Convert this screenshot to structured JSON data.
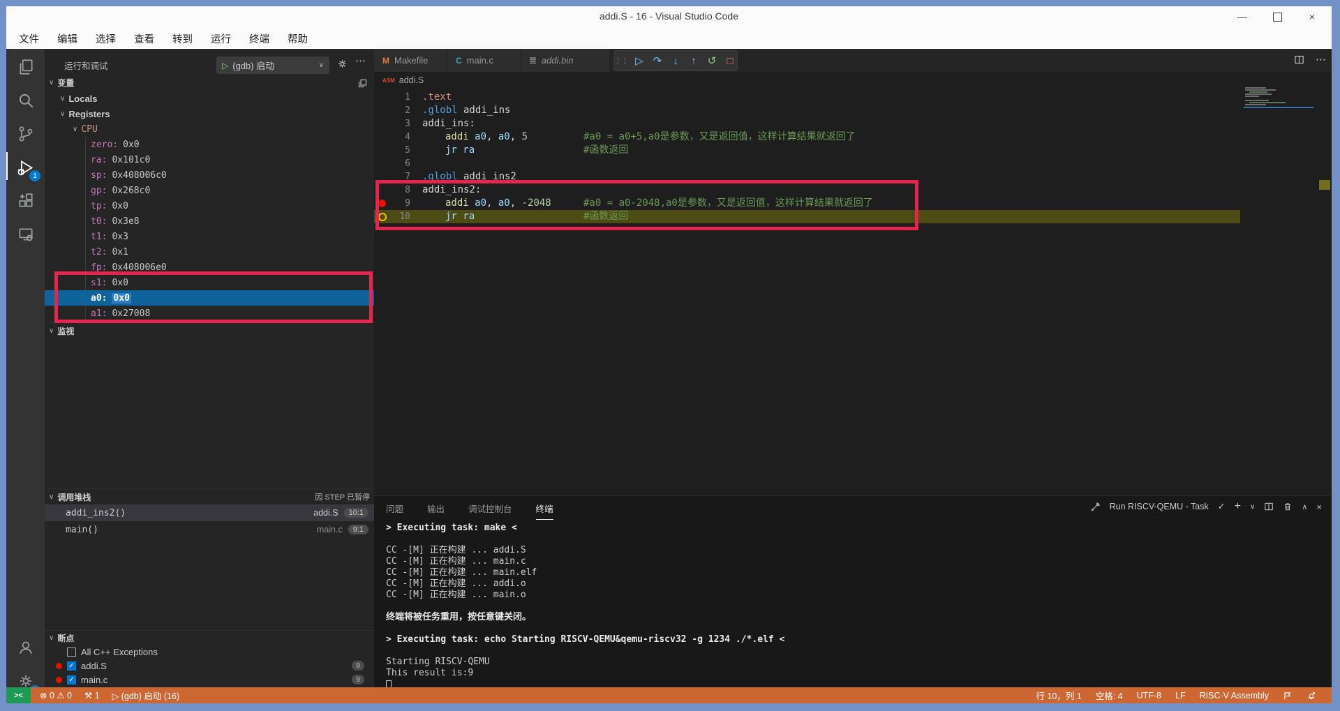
{
  "colors": {
    "annotation_red": "#e4264e",
    "status_bar_orange": "#cc6633",
    "selection_blue": "#0e639c",
    "debug_line_olive": "#4e4c15",
    "remote_green": "#1f9a55",
    "badge_blue": "#007acc"
  },
  "window": {
    "title": "addi.S - 16 - Visual Studio Code"
  },
  "menu": {
    "items": [
      "文件",
      "编辑",
      "选择",
      "查看",
      "转到",
      "运行",
      "终端",
      "帮助"
    ]
  },
  "activity_bar": {
    "debug_badge": "1",
    "settings_badge": "1"
  },
  "sidebar": {
    "title": "运行和调试",
    "launch_config": "(gdb) 启动",
    "variables_label": "变量",
    "tree": {
      "locals": "Locals",
      "registers": "Registers",
      "cpu": "CPU"
    },
    "registers": [
      {
        "name": "zero",
        "value": "0x0",
        "selected": false
      },
      {
        "name": "ra",
        "value": "0x101c0",
        "selected": false
      },
      {
        "name": "sp",
        "value": "0x408006c0",
        "selected": false
      },
      {
        "name": "gp",
        "value": "0x268c0",
        "selected": false
      },
      {
        "name": "tp",
        "value": "0x0",
        "selected": false
      },
      {
        "name": "t0",
        "value": "0x3e8",
        "selected": false
      },
      {
        "name": "t1",
        "value": "0x3",
        "selected": false
      },
      {
        "name": "t2",
        "value": "0x1",
        "selected": false
      },
      {
        "name": "fp",
        "value": "0x408006e0",
        "selected": false
      },
      {
        "name": "s1",
        "value": "0x0",
        "selected": false
      },
      {
        "name": "a0",
        "value": "0x0",
        "selected": true
      },
      {
        "name": "a1",
        "value": "0x27008",
        "selected": false
      }
    ],
    "watch_label": "监视",
    "call_stack": {
      "label": "调用堆栈",
      "status": "因 STEP 已暂停",
      "frames": [
        {
          "func": "addi_ins2()",
          "file": "addi.S",
          "position": "10:1",
          "selected": true
        },
        {
          "func": "main()",
          "file": "main.c",
          "position": "9:1",
          "selected": false
        }
      ]
    },
    "breakpoints": {
      "label": "断点",
      "items": [
        {
          "label": "All C++ Exceptions",
          "checked": false,
          "dot": false,
          "badge": ""
        },
        {
          "label": "addi.S",
          "checked": true,
          "dot": true,
          "badge": "9"
        },
        {
          "label": "main.c",
          "checked": true,
          "dot": true,
          "badge": "9"
        }
      ]
    }
  },
  "editor": {
    "tabs": [
      {
        "label": "Makefile",
        "icon": "M",
        "italic": false
      },
      {
        "label": "main.c",
        "icon": "C",
        "italic": false
      },
      {
        "label": "addi.bin",
        "icon": "bin",
        "italic": true
      }
    ],
    "breadcrumb": {
      "icon": "ASM",
      "file": "addi.S"
    },
    "lines": [
      {
        "num": "1",
        "indent": 0,
        "segs": [
          [
            "dir",
            ".text"
          ]
        ],
        "comment": "",
        "bp": "",
        "current": false
      },
      {
        "num": "2",
        "indent": 0,
        "segs": [
          [
            "kw",
            ".globl"
          ],
          [
            "pl",
            " addi_ins"
          ]
        ],
        "comment": "",
        "bp": "",
        "current": false
      },
      {
        "num": "3",
        "indent": 0,
        "segs": [
          [
            "pl",
            "addi_ins:"
          ]
        ],
        "comment": "",
        "bp": "",
        "current": false
      },
      {
        "num": "4",
        "indent": 1,
        "segs": [
          [
            "mn",
            "addi"
          ],
          [
            "pl",
            " "
          ],
          [
            "reg",
            "a0"
          ],
          [
            "pl",
            ", "
          ],
          [
            "reg",
            "a0"
          ],
          [
            "pl",
            ", "
          ],
          [
            "num",
            "5"
          ]
        ],
        "comment": "#a0 = a0+5,a0是参数，又是返回值，这样计算结果就返回了",
        "bp": "",
        "current": false
      },
      {
        "num": "5",
        "indent": 1,
        "segs": [
          [
            "jr",
            "jr ra"
          ]
        ],
        "comment": "#函数返回",
        "bp": "",
        "current": false
      },
      {
        "num": "6",
        "indent": 0,
        "segs": [],
        "comment": "",
        "bp": "",
        "current": false
      },
      {
        "num": "7",
        "indent": 0,
        "segs": [
          [
            "kw",
            ".globl"
          ],
          [
            "pl",
            " addi_ins2"
          ]
        ],
        "comment": "",
        "bp": "",
        "current": false
      },
      {
        "num": "8",
        "indent": 0,
        "segs": [
          [
            "pl",
            "addi_ins2:"
          ]
        ],
        "comment": "",
        "bp": "",
        "current": false
      },
      {
        "num": "9",
        "indent": 1,
        "segs": [
          [
            "mn",
            "addi"
          ],
          [
            "pl",
            " "
          ],
          [
            "reg",
            "a0"
          ],
          [
            "pl",
            ", "
          ],
          [
            "reg",
            "a0"
          ],
          [
            "pl",
            ", "
          ],
          [
            "num",
            "-2048"
          ]
        ],
        "comment": "#a0 = a0-2048,a0是参数，又是返回值，这样计算结果就返回了",
        "bp": "red",
        "current": false
      },
      {
        "num": "10",
        "indent": 1,
        "segs": [
          [
            "jr",
            "jr ra"
          ]
        ],
        "comment": "#函数返回",
        "bp": "current",
        "current": true
      }
    ]
  },
  "debug_toolbar": {
    "buttons": [
      "drag-grip",
      "continue",
      "step-over",
      "step-into",
      "step-out",
      "restart",
      "stop"
    ]
  },
  "panel": {
    "tabs": [
      {
        "label": "问题",
        "active": false
      },
      {
        "label": "输出",
        "active": false
      },
      {
        "label": "调试控制台",
        "active": false
      },
      {
        "label": "终端",
        "active": true
      }
    ],
    "task_label": "Run RISCV-QEMU - Task",
    "terminal_lines": [
      {
        "text": "> Executing task: make <",
        "bold": true
      },
      {
        "text": "",
        "bold": false
      },
      {
        "text": "CC -[M] 正在构建 ... addi.S",
        "bold": false
      },
      {
        "text": "CC -[M] 正在构建 ... main.c",
        "bold": false
      },
      {
        "text": "CC -[M] 正在构建 ... main.elf",
        "bold": false
      },
      {
        "text": "CC -[M] 正在构建 ... addi.o",
        "bold": false
      },
      {
        "text": "CC -[M] 正在构建 ... main.o",
        "bold": false
      },
      {
        "text": "",
        "bold": false
      },
      {
        "text": "终端将被任务重用，按任意键关闭。",
        "bold": true
      },
      {
        "text": "",
        "bold": false
      },
      {
        "text": "> Executing task: echo Starting RISCV-QEMU&qemu-riscv32 -g 1234 ./*.elf <",
        "bold": true
      },
      {
        "text": "",
        "bold": false
      },
      {
        "text": "Starting RISCV-QEMU",
        "bold": false
      },
      {
        "text": "This result is:9",
        "bold": false
      }
    ]
  },
  "status_bar": {
    "left": [
      {
        "name": "problems",
        "errors": "0",
        "warnings": "0"
      },
      {
        "name": "tasks",
        "label": "1"
      },
      {
        "name": "debug-session",
        "label": "(gdb) 启动 (16)"
      }
    ],
    "right": [
      {
        "name": "cursor-position",
        "label": "行 10，列 1"
      },
      {
        "name": "indentation",
        "label": "空格: 4"
      },
      {
        "name": "encoding",
        "label": "UTF-8"
      },
      {
        "name": "eol",
        "label": "LF"
      },
      {
        "name": "language-mode",
        "label": "RISC-V Assembly"
      }
    ]
  }
}
